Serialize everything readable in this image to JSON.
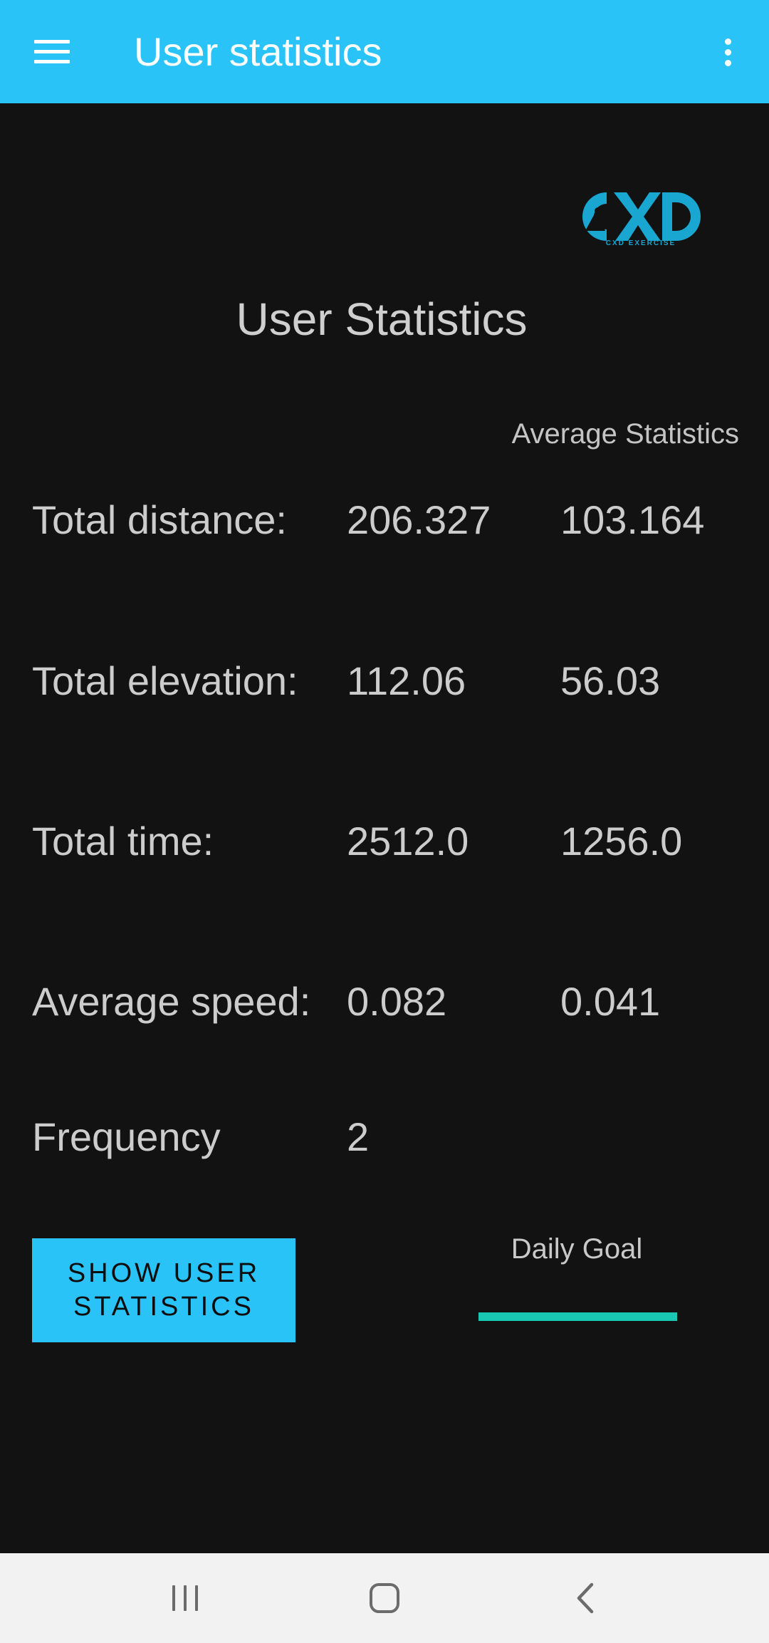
{
  "appbar": {
    "title": "User statistics",
    "menu_icon": "hamburger-menu-icon",
    "overflow_icon": "more-vertical-icon",
    "background_color": "#29c3f7"
  },
  "logo": {
    "text": "CXD",
    "subtext": "CXD EXERCISE",
    "color": "#19a6d1"
  },
  "page_title": "User Statistics",
  "columns": {
    "average_header": "Average Statistics"
  },
  "stats": [
    {
      "label": "Total distance:",
      "total": "206.327",
      "average": "103.164"
    },
    {
      "label": "Total elevation:",
      "total": "112.06",
      "average": "56.03"
    },
    {
      "label": "Total time:",
      "total": "2512.0",
      "average": "1256.0"
    },
    {
      "label": "Average speed:",
      "total": "0.082",
      "average": "0.041"
    },
    {
      "label": "Frequency",
      "total": "2",
      "average": ""
    }
  ],
  "actions": {
    "show_button_label": "SHOW USER\nSTATISTICS"
  },
  "daily_goal": {
    "label": "Daily Goal",
    "progress_percent": 100,
    "color": "#19c9b3"
  },
  "navbar": {
    "recents_icon": "recent-apps-icon",
    "home_icon": "home-icon",
    "back_icon": "back-icon"
  }
}
